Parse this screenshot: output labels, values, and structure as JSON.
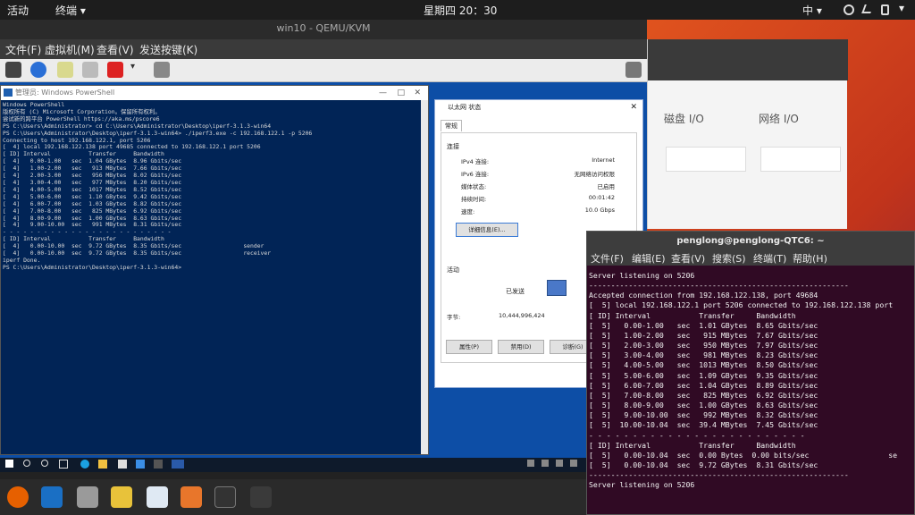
{
  "topbar": {
    "activities": "活动",
    "app": "终端 ▾",
    "clock": "星期四 20：30",
    "ime": "中 ▾"
  },
  "qemu": {
    "title": "win10 - QEMU/KVM",
    "menu": [
      "文件(F)",
      "虚拟机(M)",
      "查看(V)",
      "发送按键(K)"
    ]
  },
  "sysmon": {
    "tab_disk": "磁盘 I/O",
    "tab_net": "网络 I/O"
  },
  "ps": {
    "title": "管理员: Windows PowerShell",
    "lines": [
      "Windows PowerShell",
      "版权所有 (C) Microsoft Corporation。保留所有权利。",
      "",
      "尝试新的跨平台 PowerShell https://aka.ms/pscore6",
      "",
      "PS C:\\Users\\Administrator> cd C:\\Users\\Administrator\\Desktop\\iperf-3.1.3-win64",
      "PS C:\\Users\\Administrator\\Desktop\\iperf-3.1.3-win64> ./iperf3.exe -c 192.168.122.1 -p 5206",
      "Connecting to host 192.168.122.1, port 5206",
      "[  4] local 192.168.122.138 port 49685 connected to 192.168.122.1 port 5206",
      "[ ID] Interval           Transfer     Bandwidth",
      "[  4]   0.00-1.00   sec  1.04 GBytes  8.96 Gbits/sec",
      "[  4]   1.00-2.00   sec   913 MBytes  7.66 Gbits/sec",
      "[  4]   2.00-3.00   sec   956 MBytes  8.02 Gbits/sec",
      "[  4]   3.00-4.00   sec   977 MBytes  8.20 Gbits/sec",
      "[  4]   4.00-5.00   sec  1017 MBytes  8.52 Gbits/sec",
      "[  4]   5.00-6.00   sec  1.10 GBytes  9.42 Gbits/sec",
      "[  4]   6.00-7.00   sec  1.03 GBytes  8.82 Gbits/sec",
      "[  4]   7.00-8.00   sec   825 MBytes  6.92 Gbits/sec",
      "[  4]   8.00-9.00   sec  1.00 GBytes  8.63 Gbits/sec",
      "[  4]   9.00-10.00  sec   991 MBytes  8.31 Gbits/sec",
      "- - - - - - - - - - - - - - - - - - - - - - - - -",
      "[ ID] Interval           Transfer     Bandwidth",
      "[  4]   0.00-10.00  sec  9.72 GBytes  8.35 Gbits/sec                  sender",
      "[  4]   0.00-10.00  sec  9.72 GBytes  8.35 Gbits/sec                  receiver",
      "",
      "iperf Done.",
      "PS C:\\Users\\Administrator\\Desktop\\iperf-3.1.3-win64>"
    ]
  },
  "eth": {
    "title": "以太网 状态",
    "tab": "常规",
    "conn_header": "连接",
    "rows": [
      {
        "label": "IPv4 连接:",
        "value": "Internet"
      },
      {
        "label": "IPv6 连接:",
        "value": "无网络访问权限"
      },
      {
        "label": "媒体状态:",
        "value": "已启用"
      },
      {
        "label": "持续时间:",
        "value": "00:01:42"
      },
      {
        "label": "速度:",
        "value": "10.0 Gbps"
      }
    ],
    "details_btn": "详细信息(E)...",
    "activity_header": "活动",
    "sent": "已发送",
    "bytes_label": "字节:",
    "bytes_value": "10,444,996,424",
    "btn_props": "属性(P)",
    "btn_disable": "禁用(D)",
    "btn_diag": "诊断(G)"
  },
  "term": {
    "title": "penglong@penglong-QTC6: ~",
    "menu": [
      "文件(F)",
      "编辑(E)",
      "查看(V)",
      "搜索(S)",
      "终端(T)",
      "帮助(H)"
    ],
    "lines": [
      "Server listening on 5206",
      "-----------------------------------------------------------",
      "Accepted connection from 192.168.122.138, port 49684",
      "[  5] local 192.168.122.1 port 5206 connected to 192.168.122.138 port",
      "[ ID] Interval           Transfer     Bandwidth",
      "[  5]   0.00-1.00   sec  1.01 GBytes  8.65 Gbits/sec",
      "[  5]   1.00-2.00   sec   915 MBytes  7.67 Gbits/sec",
      "[  5]   2.00-3.00   sec   950 MBytes  7.97 Gbits/sec",
      "[  5]   3.00-4.00   sec   981 MBytes  8.23 Gbits/sec",
      "[  5]   4.00-5.00   sec  1013 MBytes  8.50 Gbits/sec",
      "[  5]   5.00-6.00   sec  1.09 GBytes  9.35 Gbits/sec",
      "[  5]   6.00-7.00   sec  1.04 GBytes  8.89 Gbits/sec",
      "[  5]   7.00-8.00   sec   825 MBytes  6.92 Gbits/sec",
      "[  5]   8.00-9.00   sec  1.00 GBytes  8.63 Gbits/sec",
      "[  5]   9.00-10.00  sec   992 MBytes  8.32 Gbits/sec",
      "[  5]  10.00-10.04  sec  39.4 MBytes  7.45 Gbits/sec",
      "- - - - - - - - - - - - - - - - - - - - - - - - -",
      "[ ID] Interval           Transfer     Bandwidth",
      "[  5]   0.00-10.04  sec  0.00 Bytes  0.00 bits/sec                  se",
      "[  5]   0.00-10.04  sec  9.72 GBytes  8.31 Gbits/sec",
      "-----------------------------------------------------------",
      "Server listening on 5206"
    ]
  }
}
